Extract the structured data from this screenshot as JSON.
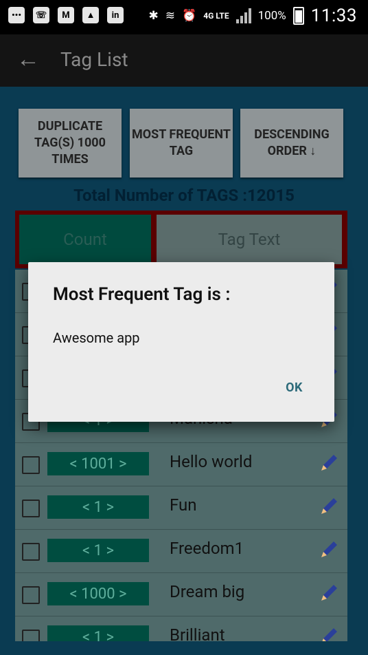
{
  "status_bar": {
    "battery": "100%",
    "time": "11:33",
    "network": "4G LTE"
  },
  "app_bar": {
    "title": "Tag List"
  },
  "buttons": {
    "duplicate": "DUPLICATE TAG(S) 1000 TIMES",
    "most_frequent": "MOST FREQUENT TAG",
    "descending": "DESCENDING ORDER ↓"
  },
  "total_label": "Total Number of TAGS :12015",
  "table": {
    "count_header": "Count",
    "text_header": "Tag Text",
    "rows": [
      {
        "count": "",
        "text": ""
      },
      {
        "count": "",
        "text": ""
      },
      {
        "count": "",
        "text": ""
      },
      {
        "count": "< 1 >",
        "text": "Manisha"
      },
      {
        "count": "< 1001 >",
        "text": "Hello world"
      },
      {
        "count": "< 1 >",
        "text": "Fun"
      },
      {
        "count": "< 1 >",
        "text": "Freedom1"
      },
      {
        "count": "< 1000 >",
        "text": "Dream big"
      },
      {
        "count": "< 1 >",
        "text": "Brilliant"
      }
    ]
  },
  "dialog": {
    "title": "Most Frequent Tag is :",
    "message": "Awesome app",
    "ok": "OK"
  }
}
